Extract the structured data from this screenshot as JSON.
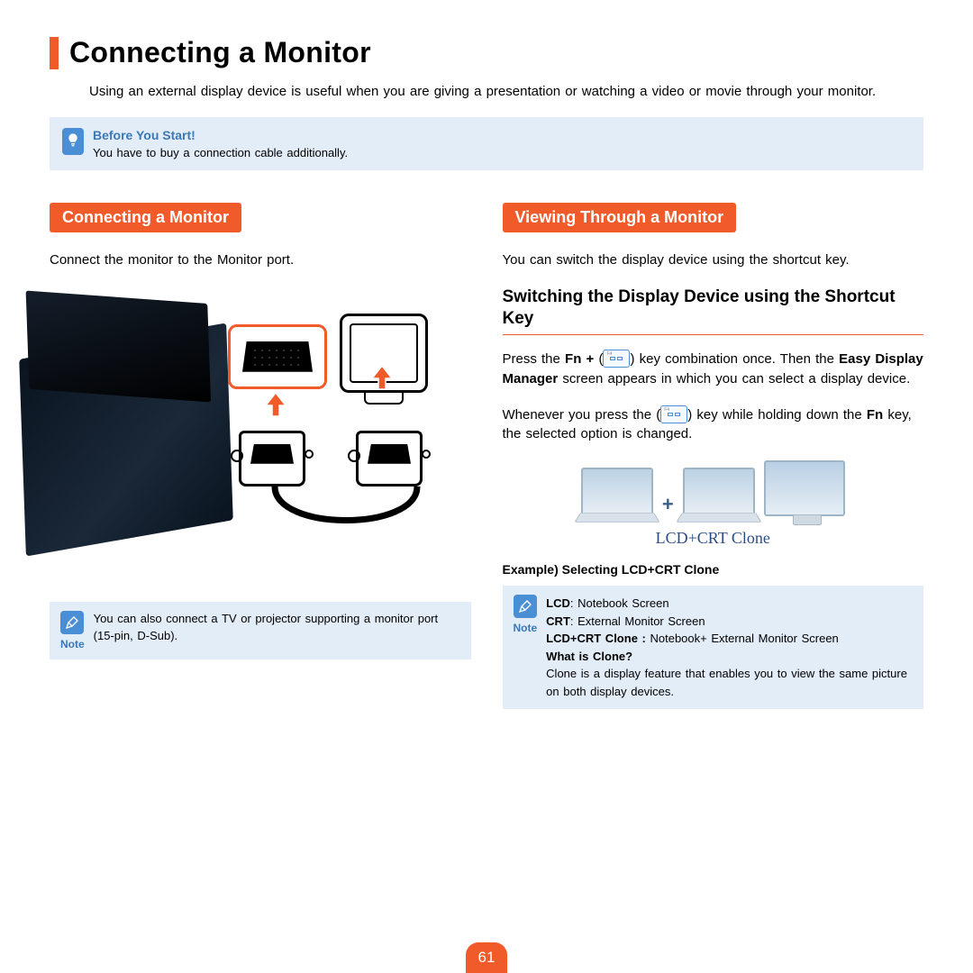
{
  "page_title": "Connecting a Monitor",
  "intro": "Using an external display device is useful when you are giving a presentation or watching a video or movie through your monitor.",
  "before_start": {
    "heading": "Before You Start!",
    "text": "You have to buy a connection cable additionally."
  },
  "left": {
    "section_heading": "Connecting a Monitor",
    "instruction": "Connect the monitor to the Monitor port.",
    "note_label": "Note",
    "note_text": "You can also connect a TV or projector supporting a monitor port (15-pin, D-Sub)."
  },
  "right": {
    "section_heading": "Viewing Through a Monitor",
    "intro": "You can switch the display device using the shortcut key.",
    "sub_heading": "Switching the Display Device using the Shortcut Key",
    "para1_pre": "Press the ",
    "para1_bold1": "Fn +",
    "para1_mid": " (",
    "para1_post": ") key combination once. Then the ",
    "para1_bold2": "Easy Display Manager",
    "para1_tail": " screen appears in which you can select a display device.",
    "para2_pre": "Whenever you press the (",
    "para2_mid": ") key while holding down the ",
    "para2_bold": "Fn",
    "para2_post": " key, the selected option is changed.",
    "clone_caption": "LCD+CRT Clone",
    "example_caption": "Example) Selecting LCD+CRT Clone",
    "note_label": "Note",
    "defs": {
      "lcd_label": "LCD",
      "lcd_text": ": Notebook Screen",
      "crt_label": "CRT",
      "crt_text": ": External Monitor Screen",
      "clone_label": "LCD+CRT Clone :",
      "clone_text": " Notebook+ External Monitor Screen",
      "what_is": "What is Clone?",
      "what_is_text": "Clone is a display feature that enables you to view the same picture on both display devices."
    }
  },
  "page_number": "61"
}
